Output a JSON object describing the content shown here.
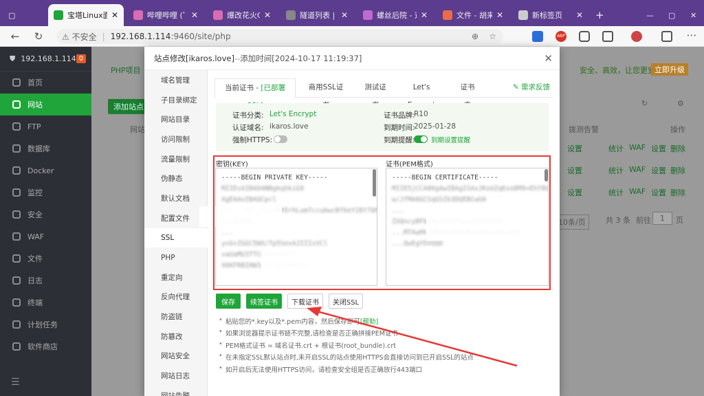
{
  "browser": {
    "tabs": [
      {
        "label": "宝塔Linux面板",
        "color": "#20a53a",
        "active": true
      },
      {
        "label": "哔哩哔哩 (゜-゜",
        "color": "#d96cb3",
        "active": false
      },
      {
        "label": "爆改花火CV赵",
        "color": "#d96cb3",
        "active": false
      },
      {
        "label": "隧道列表 | Sak",
        "color": "#888888",
        "active": false
      },
      {
        "label": "螺丝后院 - 道",
        "color": "#c06ad0",
        "active": false
      },
      {
        "label": "文件 - 胡来的",
        "color": "#e86c4a",
        "active": false
      },
      {
        "label": "新标签页",
        "color": "#cccccc",
        "active": false
      }
    ],
    "new_tab": "+",
    "back": "←",
    "reload": "↻",
    "insecure": "不安全",
    "url_host": "192.168.1.114",
    "url_path": ":9460/site/php",
    "ext_labels": [
      "ABP"
    ]
  },
  "sidebar": {
    "host": "192.168.1.114",
    "badge": "0",
    "items": [
      {
        "label": "首页",
        "active": false
      },
      {
        "label": "网站",
        "active": true
      },
      {
        "label": "FTP",
        "active": false
      },
      {
        "label": "数据库",
        "active": false
      },
      {
        "label": "Docker",
        "active": false
      },
      {
        "label": "监控",
        "active": false
      },
      {
        "label": "安全",
        "active": false
      },
      {
        "label": "WAF",
        "active": false
      },
      {
        "label": "文件",
        "active": false
      },
      {
        "label": "日志",
        "active": false
      },
      {
        "label": "终端",
        "active": false
      },
      {
        "label": "计划任务",
        "active": false
      },
      {
        "label": "软件商店",
        "active": false
      }
    ]
  },
  "page": {
    "tab_php": "PHP项目",
    "add_site": "添加站点",
    "col_site": "网站名",
    "col_waf": "拨测告警",
    "col_ops": "操作",
    "promo": "安全、高效，让您更安心",
    "upgrade": "立即升级",
    "rows": [
      {
        "settings": "设置",
        "stats": "统计",
        "waf": "WAF",
        "set": "设置",
        "del": "删除"
      },
      {
        "settings": "设置",
        "stats": "统计",
        "waf": "WAF",
        "set": "设置",
        "del": "删除"
      },
      {
        "settings": "设置",
        "stats": "统计",
        "waf": "WAF",
        "set": "设置",
        "del": "删除"
      }
    ],
    "per_page": "10条/页",
    "total": "共 3 条",
    "goto": "前往",
    "page_num": "1",
    "page_unit": "页"
  },
  "modal": {
    "title_main": "站点修改[ikaros.love]",
    "title_sep": " -- ",
    "title_time": "添加时间[2024-10-17 11:19:37]",
    "close": "✕",
    "menu": [
      "域名管理",
      "子目录绑定",
      "网站目录",
      "访问限制",
      "流量限制",
      "伪静态",
      "默认文档",
      "配置文件",
      "SSL",
      "PHP",
      "重定向",
      "反向代理",
      "防盗链",
      "防篡改",
      "网站安全",
      "网站日志",
      "网站告警"
    ],
    "menu_active": 8,
    "subtabs": {
      "current_prefix": "当前证书 - ",
      "current_status": "[已部署SSL]",
      "commercial": "商用SSL证书",
      "test": "测试证书",
      "letsencrypt": "Let's Encrypt",
      "folder": "证书夹"
    },
    "feedback": "需求反馈",
    "info": {
      "type_label": "证书分类:",
      "type_value": "Let's Encrypt",
      "domain_label": "认证域名:",
      "domain_value": "ikaros.love",
      "https_label": "强制HTTPS:",
      "brand_label": "证书品牌:",
      "brand_value": "R10",
      "expire_label": "到期时间:",
      "expire_value": "2025-01-28",
      "remind_label": "到期提醒:",
      "remind_link": "到期设置提醒",
      "https_on": false,
      "remind_on": true
    },
    "key_label": "密钥(KEY)",
    "cert_label": "证书(PEM格式)",
    "key_lines": [
      "-----BEGIN PRIVATE KEY-----",
      "MIIEvAIBADANBgkqhkiG9",
      "AgEAAoIBAQCpcl",
      "f6r...mKj/Jh2qNR5rhLum7ccubwcBf6eY28Y7bM",
      "wzcWQkMK...",
      "...",
      "yvG+ZGGC5WX/Tp5SevAJIIIxVCl",
      "vaUaMU3TTCeSOPoUm2F...",
      "X6KFRBIHW3j97J4I2XYFil"
    ],
    "cert_lines": [
      "-----BEGIN CERTIFICATE-----",
      "MIIE5jCCA86gAwIBAgISAxJKoUZqKxo8M9+EhY8U",
      "w/JfMA0GCSqGSIb3DQEBCwUA",
      "...",
      "ZXQncyBFbmNyeXB0MQwwCgYDVQQD",
      "...MTAwHhcNMjQxMDMwMjMwMzAwWhcNMj",
      "...QwEgYDVQQD"
    ],
    "buttons": {
      "save": "保存",
      "renew": "续签证书",
      "download": "下载证书",
      "close_ssl": "关闭SSL"
    },
    "tips": [
      {
        "text": "粘贴您的*.key以及*.pem内容，然后保存即可",
        "link": "[帮助]"
      },
      {
        "text": "如果浏览器提示证书链不完整,请检查是否正确拼接PEM证书",
        "link": ""
      },
      {
        "text": "PEM格式证书 = 域名证书.crt + 根证书(root_bundle).crt",
        "link": ""
      },
      {
        "text": "在未指定SSL默认站点时,未开启SSL的站点使用HTTPS会直接访问到已开启SSL的站点",
        "link": ""
      },
      {
        "text": "如开启后无法使用HTTPS访问，请检查安全组是否正确放行443端口",
        "link": ""
      }
    ]
  },
  "colors": {
    "brand": "#20a53a",
    "annotation": "#e53935",
    "tabstrip": "#5b3c8f"
  }
}
